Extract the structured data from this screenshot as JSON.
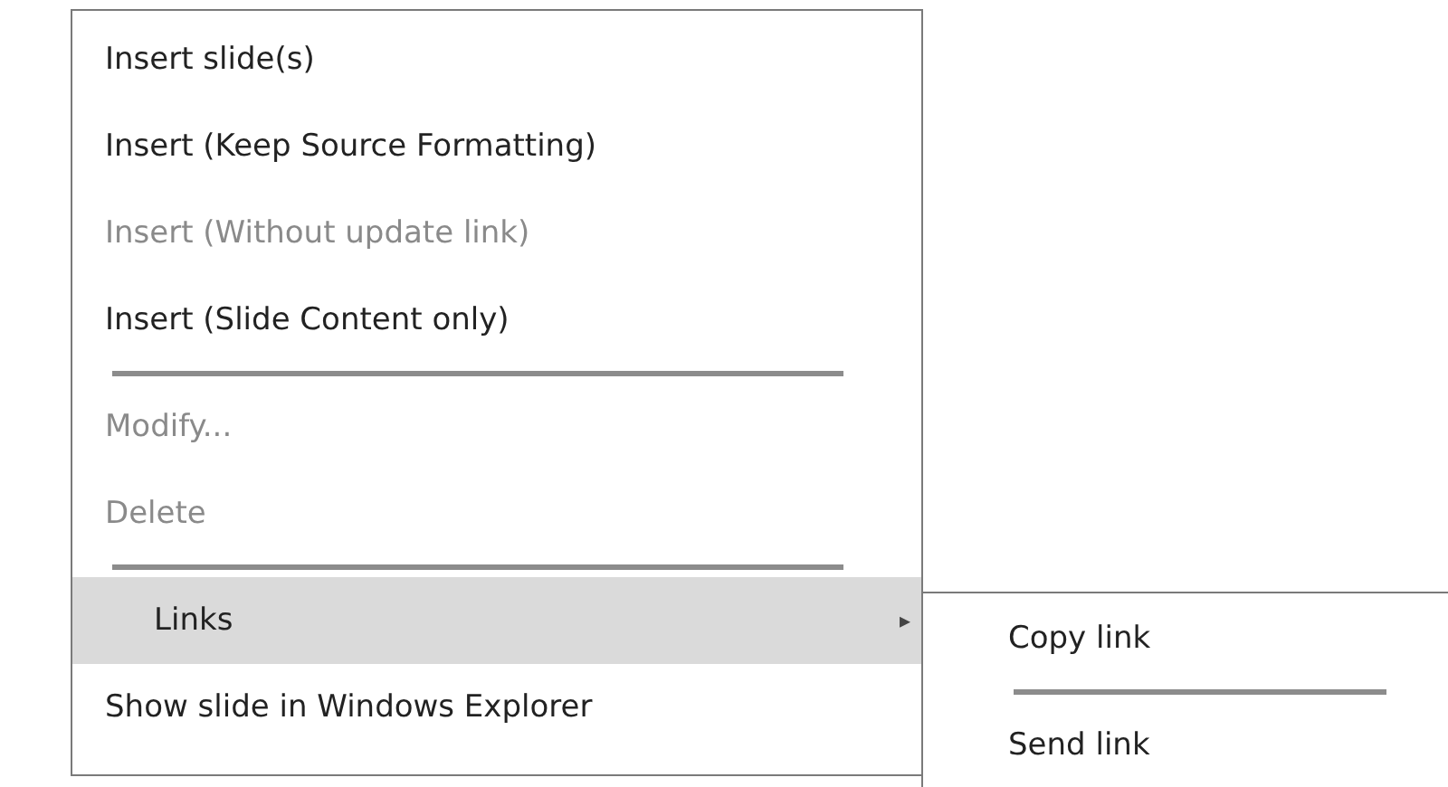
{
  "menu": {
    "items": [
      {
        "kind": "item",
        "label": "Insert slide(s)",
        "disabled": false,
        "selected": false
      },
      {
        "kind": "item",
        "label": "Insert (Keep Source Formatting)",
        "disabled": false,
        "selected": false
      },
      {
        "kind": "item",
        "label": "Insert (Without update link)",
        "disabled": true,
        "selected": false
      },
      {
        "kind": "item",
        "label": "Insert (Slide Content only)",
        "disabled": false,
        "selected": false
      },
      {
        "kind": "separator"
      },
      {
        "kind": "item",
        "label": "Modify...",
        "disabled": true,
        "selected": false
      },
      {
        "kind": "item",
        "label": "Delete",
        "disabled": true,
        "selected": false
      },
      {
        "kind": "separator"
      },
      {
        "kind": "submenu",
        "label": "Links",
        "disabled": false,
        "selected": true,
        "arrow": "▸"
      },
      {
        "kind": "item",
        "label": "Show slide in Windows Explorer",
        "disabled": false,
        "selected": false
      }
    ]
  },
  "submenu": {
    "items": [
      {
        "kind": "item",
        "label": "Copy link",
        "disabled": false,
        "selected": false
      },
      {
        "kind": "separator"
      },
      {
        "kind": "item",
        "label": "Send link",
        "disabled": false,
        "selected": false
      }
    ]
  }
}
